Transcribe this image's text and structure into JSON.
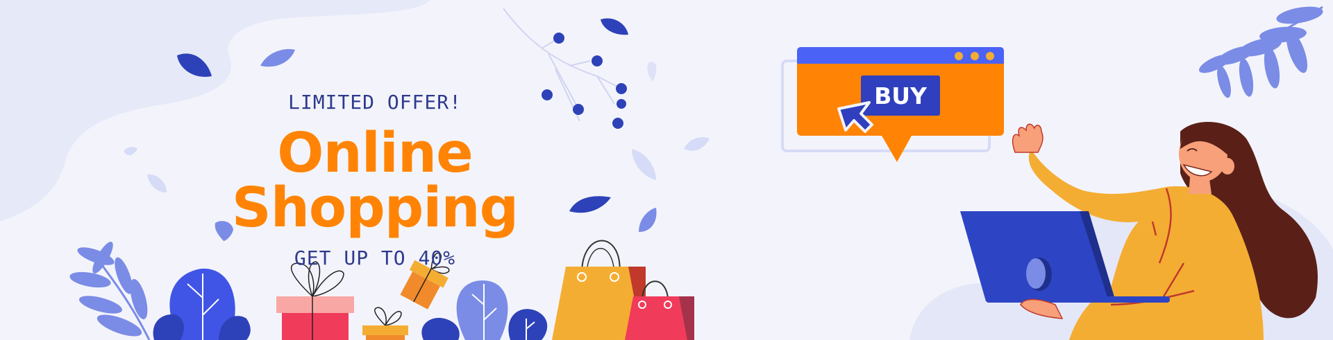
{
  "banner": {
    "eyebrow": "LIMITED OFFER!",
    "headline": "Online Shopping",
    "subline": "GET UP TO 40%"
  },
  "browser_window": {
    "buy_label": "BUY"
  },
  "colors": {
    "background": "#f3f4fb",
    "headline": "#ff8405",
    "text_navy": "#2e3a8c",
    "accent_blue": "#4a62f5",
    "accent_orange": "#ff8405",
    "buy_button": "#2f3fbd",
    "laptop": "#2d45c4",
    "sweater": "#f4ad33",
    "hair": "#5a2018",
    "gift_red": "#f13b5b",
    "gift_pink": "#f9a7a4",
    "leaf_light": "#7b8ce6",
    "leaf_dark": "#2d42b8"
  },
  "icons": [
    "cursor-arrow-icon",
    "window-dots-icon",
    "leaf-icon",
    "berry-branch-icon",
    "gift-box-icon",
    "shopping-bag-icon"
  ]
}
